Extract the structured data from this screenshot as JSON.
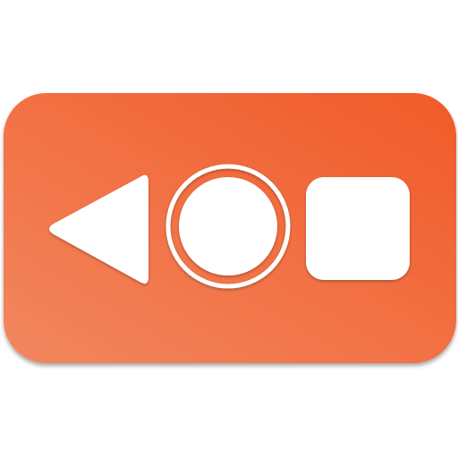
{
  "icon": {
    "badge": "navigation-bar-badge",
    "buttons": [
      "back-icon",
      "home-icon",
      "recents-icon"
    ]
  },
  "colors": {
    "badge_gradient_light": "#f2875f",
    "badge_gradient_dark": "#f15a28",
    "glyph": "#ffffff"
  }
}
